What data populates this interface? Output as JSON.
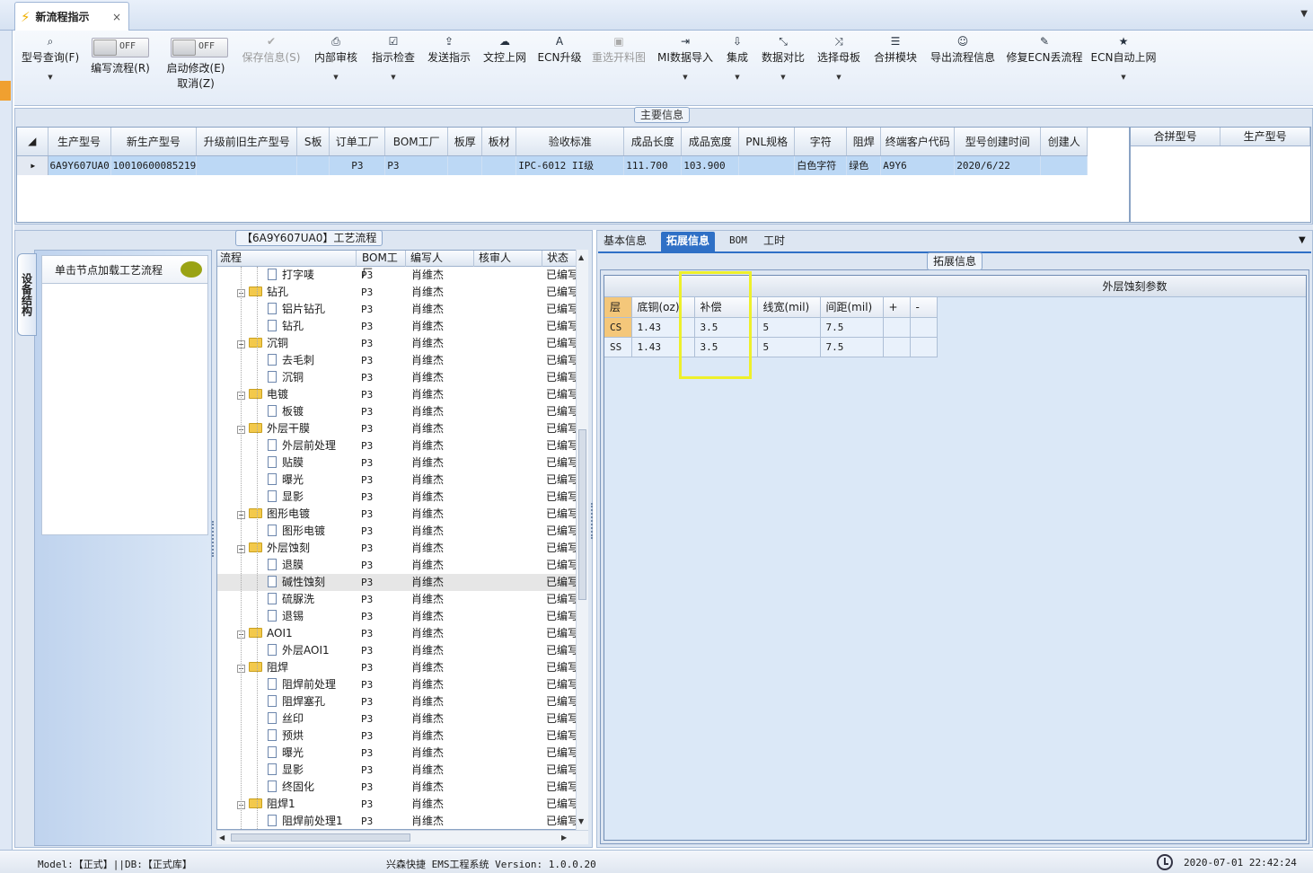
{
  "tab": {
    "title": "新流程指示",
    "close": "×"
  },
  "toolbar": {
    "items": [
      {
        "label": "型号查询(F)",
        "icon": "search-icon",
        "glyph": "⌕"
      },
      {
        "label": "保存信息(S)",
        "icon": "check-icon",
        "glyph": "✔"
      },
      {
        "label": "内部审核",
        "icon": "print-icon",
        "glyph": "⎙"
      },
      {
        "label": "指示检查",
        "icon": "checkbox-icon",
        "glyph": "☑"
      },
      {
        "label": "发送指示",
        "icon": "upload-icon",
        "glyph": "⇪"
      },
      {
        "label": "文控上网",
        "icon": "cloud-upload-icon",
        "glyph": "☁"
      },
      {
        "label": "ECN升级",
        "icon": "font-icon",
        "glyph": "A"
      },
      {
        "label": "重选开料图",
        "icon": "image-icon",
        "glyph": "▣"
      },
      {
        "label": "MI数据导入",
        "icon": "import-icon",
        "glyph": "⇥"
      },
      {
        "label": "集成",
        "icon": "download-icon",
        "glyph": "⇩"
      },
      {
        "label": "数据对比",
        "icon": "compress-icon",
        "glyph": "⤡"
      },
      {
        "label": "选择母板",
        "icon": "shuffle-icon",
        "glyph": "⤨"
      },
      {
        "label": "合拼模块",
        "icon": "list-icon",
        "glyph": "☰"
      },
      {
        "label": "导出流程信息",
        "icon": "smile-icon",
        "glyph": "☺"
      },
      {
        "label": "修复ECN丢流程",
        "icon": "wrench-icon",
        "glyph": "✎"
      },
      {
        "label": "ECN自动上网",
        "icon": "star-icon",
        "glyph": "★"
      }
    ],
    "toggle1": {
      "state": "OFF",
      "label": "编写流程(R)"
    },
    "toggle2": {
      "state": "OFF",
      "label1": "启动修改(E)",
      "label2": "取消(Z)"
    }
  },
  "main_info": {
    "title": "主要信息",
    "columns": [
      "生产型号",
      "新生产型号",
      "升级前旧生产型号",
      "S板",
      "订单工厂",
      "BOM工厂",
      "板厚",
      "板材",
      "验收标准",
      "成品长度",
      "成品宽度",
      "PNL规格",
      "字符",
      "阻焊",
      "终端客户代码",
      "型号创建时间",
      "创建人"
    ],
    "row": [
      "6A9Y607UA0",
      "10010600085219",
      "",
      "",
      "P3",
      "P3",
      "",
      "",
      "IPC-6012 II级",
      "111.700",
      "103.900",
      "",
      "白色字符",
      "绿色",
      "A9Y6",
      "2020/6/22",
      ""
    ],
    "row_marker": "▶",
    "side_columns": [
      "合拼型号",
      "生产型号"
    ]
  },
  "left_panel": {
    "vertical_tab": "设备结构",
    "nav_button": "单击节点加载工艺流程",
    "process_title": "【6A9Y607UA0】工艺流程"
  },
  "tree": {
    "columns": [
      "流程",
      "BOM工厂",
      "编写人",
      "核审人",
      "状态"
    ],
    "rows": [
      {
        "name": "打字唛",
        "type": "doc",
        "bom": "P3",
        "writer": "肖维杰",
        "status": "已编写"
      },
      {
        "name": "钻孔",
        "type": "folder",
        "bom": "P3",
        "writer": "肖维杰",
        "status": "已编写"
      },
      {
        "name": "铝片钻孔",
        "type": "doc",
        "bom": "P3",
        "writer": "肖维杰",
        "status": "已编写"
      },
      {
        "name": "钻孔",
        "type": "doc",
        "bom": "P3",
        "writer": "肖维杰",
        "status": "已编写"
      },
      {
        "name": "沉铜",
        "type": "folder",
        "bom": "P3",
        "writer": "肖维杰",
        "status": "已编写"
      },
      {
        "name": "去毛刺",
        "type": "doc",
        "bom": "P3",
        "writer": "肖维杰",
        "status": "已编写"
      },
      {
        "name": "沉铜",
        "type": "doc",
        "bom": "P3",
        "writer": "肖维杰",
        "status": "已编写"
      },
      {
        "name": "电镀",
        "type": "folder",
        "bom": "P3",
        "writer": "肖维杰",
        "status": "已编写"
      },
      {
        "name": "板镀",
        "type": "doc",
        "bom": "P3",
        "writer": "肖维杰",
        "status": "已编写"
      },
      {
        "name": "外层干膜",
        "type": "folder",
        "bom": "P3",
        "writer": "肖维杰",
        "status": "已编写"
      },
      {
        "name": "外层前处理",
        "type": "doc",
        "bom": "P3",
        "writer": "肖维杰",
        "status": "已编写"
      },
      {
        "name": "贴膜",
        "type": "doc",
        "bom": "P3",
        "writer": "肖维杰",
        "status": "已编写"
      },
      {
        "name": "曝光",
        "type": "doc",
        "bom": "P3",
        "writer": "肖维杰",
        "status": "已编写"
      },
      {
        "name": "显影",
        "type": "doc",
        "bom": "P3",
        "writer": "肖维杰",
        "status": "已编写"
      },
      {
        "name": "图形电镀",
        "type": "folder",
        "bom": "P3",
        "writer": "肖维杰",
        "status": "已编写"
      },
      {
        "name": "图形电镀",
        "type": "doc",
        "bom": "P3",
        "writer": "肖维杰",
        "status": "已编写"
      },
      {
        "name": "外层蚀刻",
        "type": "folder",
        "bom": "P3",
        "writer": "肖维杰",
        "status": "已编写"
      },
      {
        "name": "退膜",
        "type": "doc",
        "bom": "P3",
        "writer": "肖维杰",
        "status": "已编写"
      },
      {
        "name": "碱性蚀刻",
        "type": "doc",
        "bom": "P3",
        "writer": "肖维杰",
        "status": "已编写",
        "selected": true
      },
      {
        "name": "硫脲洗",
        "type": "doc",
        "bom": "P3",
        "writer": "肖维杰",
        "status": "已编写"
      },
      {
        "name": "退锡",
        "type": "doc",
        "bom": "P3",
        "writer": "肖维杰",
        "status": "已编写"
      },
      {
        "name": "AOI1",
        "type": "folder",
        "bom": "P3",
        "writer": "肖维杰",
        "status": "已编写"
      },
      {
        "name": "外层AOI1",
        "type": "doc",
        "bom": "P3",
        "writer": "肖维杰",
        "status": "已编写"
      },
      {
        "name": "阻焊",
        "type": "folder",
        "bom": "P3",
        "writer": "肖维杰",
        "status": "已编写"
      },
      {
        "name": "阻焊前处理",
        "type": "doc",
        "bom": "P3",
        "writer": "肖维杰",
        "status": "已编写"
      },
      {
        "name": "阻焊塞孔",
        "type": "doc",
        "bom": "P3",
        "writer": "肖维杰",
        "status": "已编写"
      },
      {
        "name": "丝印",
        "type": "doc",
        "bom": "P3",
        "writer": "肖维杰",
        "status": "已编写"
      },
      {
        "name": "预烘",
        "type": "doc",
        "bom": "P3",
        "writer": "肖维杰",
        "status": "已编写"
      },
      {
        "name": "曝光",
        "type": "doc",
        "bom": "P3",
        "writer": "肖维杰",
        "status": "已编写"
      },
      {
        "name": "显影",
        "type": "doc",
        "bom": "P3",
        "writer": "肖维杰",
        "status": "已编写"
      },
      {
        "name": "终固化",
        "type": "doc",
        "bom": "P3",
        "writer": "肖维杰",
        "status": "已编写"
      },
      {
        "name": "阻焊1",
        "type": "folder",
        "bom": "P3",
        "writer": "肖维杰",
        "status": "已编写"
      },
      {
        "name": "阻焊前处理1",
        "type": "doc",
        "bom": "P3",
        "writer": "肖维杰",
        "status": "已编写"
      }
    ]
  },
  "right_panel": {
    "tabs": [
      "基本信息",
      "拓展信息",
      "BOM",
      "工时"
    ],
    "group_title": "拓展信息",
    "table_caption": "外层蚀刻参数",
    "columns": [
      "层",
      "底铜(oz)",
      "补偿",
      "线宽(mil)",
      "间距(mil)",
      "+",
      "-"
    ],
    "rows": [
      [
        "CS",
        "1.43",
        "3.5",
        "5",
        "7.5",
        "",
        ""
      ],
      [
        "SS",
        "1.43",
        "3.5",
        "5",
        "7.5",
        "",
        ""
      ]
    ]
  },
  "statusbar": {
    "model": "Model:【正式】||DB:【正式库】",
    "system": "兴森快捷 EMS工程系统 Version: 1.0.0.20",
    "datetime": "2020-07-01 22:42:24"
  },
  "colors": {
    "accent": "#2f70c6",
    "selection": "#bcd8f5",
    "highlight_box": "#eef02a",
    "layer_cell": "#f4c77a"
  }
}
